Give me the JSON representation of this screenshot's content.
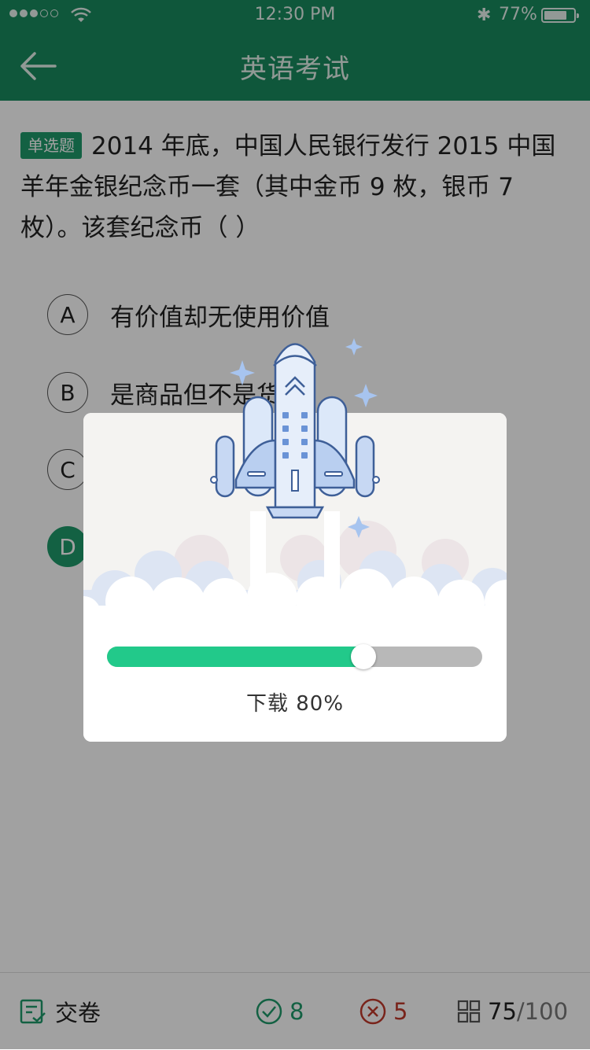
{
  "status_bar": {
    "time": "12:30 PM",
    "battery_pct": "77%",
    "battery_level": 0.77,
    "signal_bars_filled": 3,
    "signal_bars_total": 5
  },
  "header": {
    "title": "英语考试",
    "back_icon": "arrow-left-icon",
    "bg_color": "#188a5e"
  },
  "question": {
    "type_tag": "单选题",
    "text": "2014 年底，中国人民银行发行 2015 中国羊年金银纪念币一套（其中金币 9 枚，银币 7 枚）。该套纪念币（    ）"
  },
  "options": [
    {
      "letter": "A",
      "text": "有价值却无使用价值",
      "selected": false
    },
    {
      "letter": "B",
      "text": "是商品但不是货币",
      "selected": false
    },
    {
      "letter": "C",
      "text": "",
      "selected": false
    },
    {
      "letter": "D",
      "text": "",
      "selected": true
    }
  ],
  "bottom_bar": {
    "submit_label": "交卷",
    "correct_count": "8",
    "wrong_count": "5",
    "progress_current": "75",
    "progress_total": "/100",
    "correct_color": "#1f9a6a",
    "wrong_color": "#c0392b"
  },
  "download_dialog": {
    "label": "下载 80%",
    "progress": 0.8,
    "accent_color": "#22c98a",
    "illustration": "rocket-launch-illustration"
  }
}
